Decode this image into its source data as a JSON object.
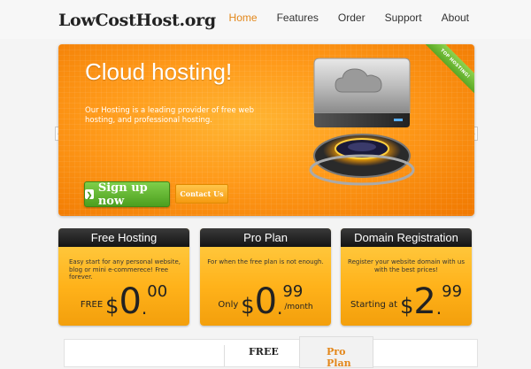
{
  "site": {
    "logo": "LowCostHost.org"
  },
  "nav": [
    {
      "label": "Home",
      "active": true
    },
    {
      "label": "Features",
      "active": false
    },
    {
      "label": "Order",
      "active": false
    },
    {
      "label": "Support",
      "active": false
    },
    {
      "label": "About",
      "active": false
    }
  ],
  "slider": {
    "title": "Cloud hosting!",
    "text": "Our Hosting is a leading provider of free web hosting, and professional hosting.",
    "signup_label": "Sign up now",
    "contact_label": "Contact Us",
    "ribbon": "TOP HOSTING!",
    "image_icon": "cloud-hard-drive-icon"
  },
  "plans": [
    {
      "title": "Free Hosting",
      "desc": "Easy start for any personal website, blog or mini e-commerece! Free forever.",
      "price_label": "FREE",
      "currency": "$",
      "amount": "0",
      "cents": "00",
      "unit": ""
    },
    {
      "title": "Pro Plan",
      "desc": "For when the free plan is not enough.",
      "price_label": "Only",
      "currency": "$",
      "amount": "0",
      "cents": "99",
      "unit": "/month"
    },
    {
      "title": "Domain Registration",
      "desc": "Register your website domain with us with the best prices!",
      "price_label": "Starting at",
      "currency": "$",
      "amount": "2",
      "cents": "99",
      "unit": ""
    }
  ],
  "comparison": {
    "col_free": "FREE",
    "col_pro": "Pro Plan"
  },
  "colors": {
    "accent": "#e3871a",
    "signup_green": "#5aa826",
    "header_dark": "#1e1e1e"
  }
}
